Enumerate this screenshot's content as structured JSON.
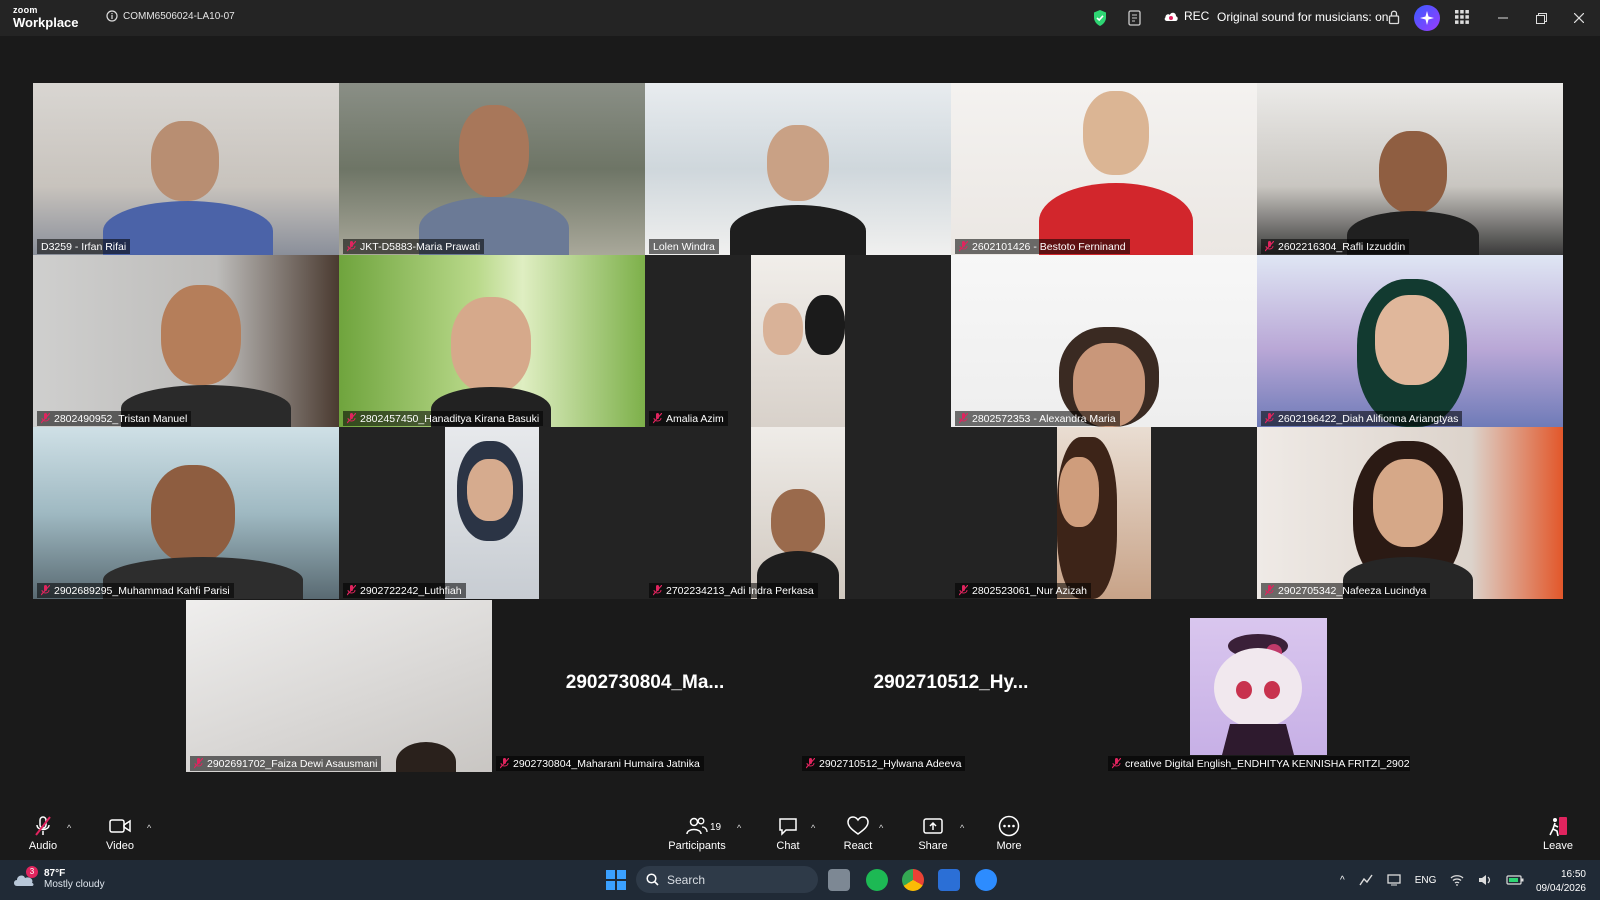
{
  "app": {
    "logo_line1": "zoom",
    "logo_line2": "Workplace",
    "meeting_id": "COMM6506024-LA10-07"
  },
  "titlebar": {
    "rec_label": "REC",
    "sound_label": "Original sound for musicians: on"
  },
  "participants": [
    {
      "name": "D3259 - Irfan Rifai",
      "muted": false,
      "active": true
    },
    {
      "name": "JKT-D5883-Maria Prawati",
      "muted": true
    },
    {
      "name": "Lolen Windra",
      "muted": false
    },
    {
      "name": "2602101426 - Bestoto Ferninand",
      "muted": true
    },
    {
      "name": "2602216304_Rafli Izzuddin",
      "muted": true
    },
    {
      "name": "2802490952_Tristan Manuel",
      "muted": true
    },
    {
      "name": "2802457450_Hanaditya Kirana Basuki",
      "muted": true
    },
    {
      "name": "Amalia Azim",
      "muted": true
    },
    {
      "name": "2802572353 - Alexandra Maria",
      "muted": true
    },
    {
      "name": "2602196422_Diah Alifionna Ariangtyas",
      "muted": true
    },
    {
      "name": "2902689295_Muhammad Kahfi Parisi",
      "muted": true
    },
    {
      "name": "2902722242_Luthfiah",
      "muted": true
    },
    {
      "name": "2702234213_Adi Indra Perkasa",
      "muted": true
    },
    {
      "name": "2802523061_Nur Azizah",
      "muted": true
    },
    {
      "name": "2902705342_Nafeeza Lucindya",
      "muted": true
    },
    {
      "name": "2902691702_Faiza Dewi Asausmani",
      "muted": true
    },
    {
      "name": "2902730804_Maharani Humaira Jatnika",
      "muted": true,
      "display": "2902730804_Ma..."
    },
    {
      "name": "2902710512_Hylwana Adeeva",
      "muted": true,
      "display": "2902710512_Hy..."
    },
    {
      "name": "creative Digital English_ENDHITYA KENNISHA FRITZI_2902...",
      "muted": true
    }
  ],
  "toolbar": {
    "audio": "Audio",
    "video": "Video",
    "participants": "Participants",
    "participants_count": "19",
    "chat": "Chat",
    "react": "React",
    "share": "Share",
    "more": "More",
    "leave": "Leave"
  },
  "taskbar": {
    "weather_badge": "3",
    "temperature": "87°F",
    "condition": "Mostly cloudy",
    "search_placeholder": "Search",
    "lang": "ENG",
    "time": "16:50",
    "date": "09/04/2026"
  },
  "colors": {
    "active_speaker": "#2ed573",
    "rec": "#ffffff",
    "muted_icon": "#e0245e",
    "leave": "#e0245e"
  }
}
